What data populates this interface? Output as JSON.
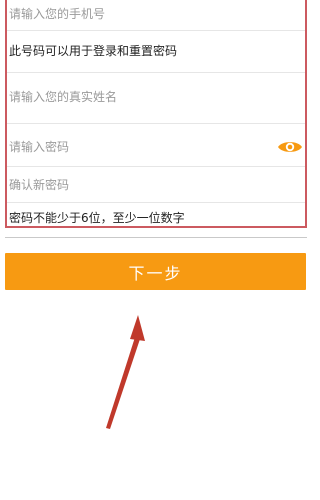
{
  "form": {
    "phone_placeholder": "请输入您的手机号",
    "phone_note": "此号码可以用于登录和重置密码",
    "name_placeholder": "请输入您的真实姓名",
    "password_placeholder": "请输入密码",
    "confirm_placeholder": "确认新密码",
    "password_rule": "密码不能少于6位，至少一位数字"
  },
  "icons": {
    "password_visibility": "eye-icon"
  },
  "next_button": {
    "label": "下一步"
  },
  "colors": {
    "accent": "#f79a12",
    "highlight_border": "#cc5a60",
    "arrow": "#c0392b"
  }
}
